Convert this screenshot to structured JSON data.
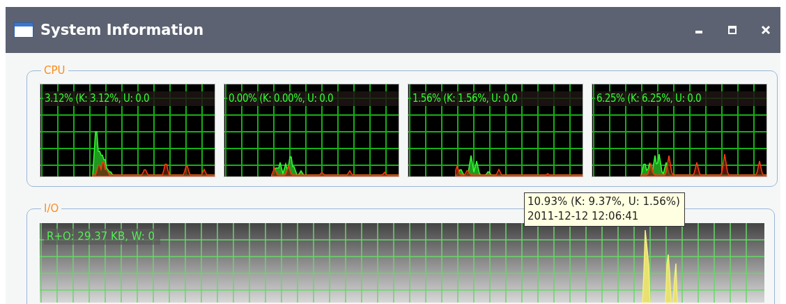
{
  "window": {
    "title": "System Information"
  },
  "cpu": {
    "label": "CPU",
    "cores": [
      {
        "reading": "3.12% (K: 3.12%, U: 0.0"
      },
      {
        "reading": "0.00% (K: 0.00%, U: 0.0"
      },
      {
        "reading": "1.56% (K: 1.56%, U: 0.0"
      },
      {
        "reading": "6.25% (K: 6.25%, U: 0.0"
      }
    ]
  },
  "io": {
    "label": "I/O",
    "reading": "R+O: 29.37 KB, W: 0"
  },
  "tooltip": {
    "lines": [
      "10.93% (K: 9.37%, U: 1.56%)",
      "2011-12-12 12:06:41"
    ]
  }
}
